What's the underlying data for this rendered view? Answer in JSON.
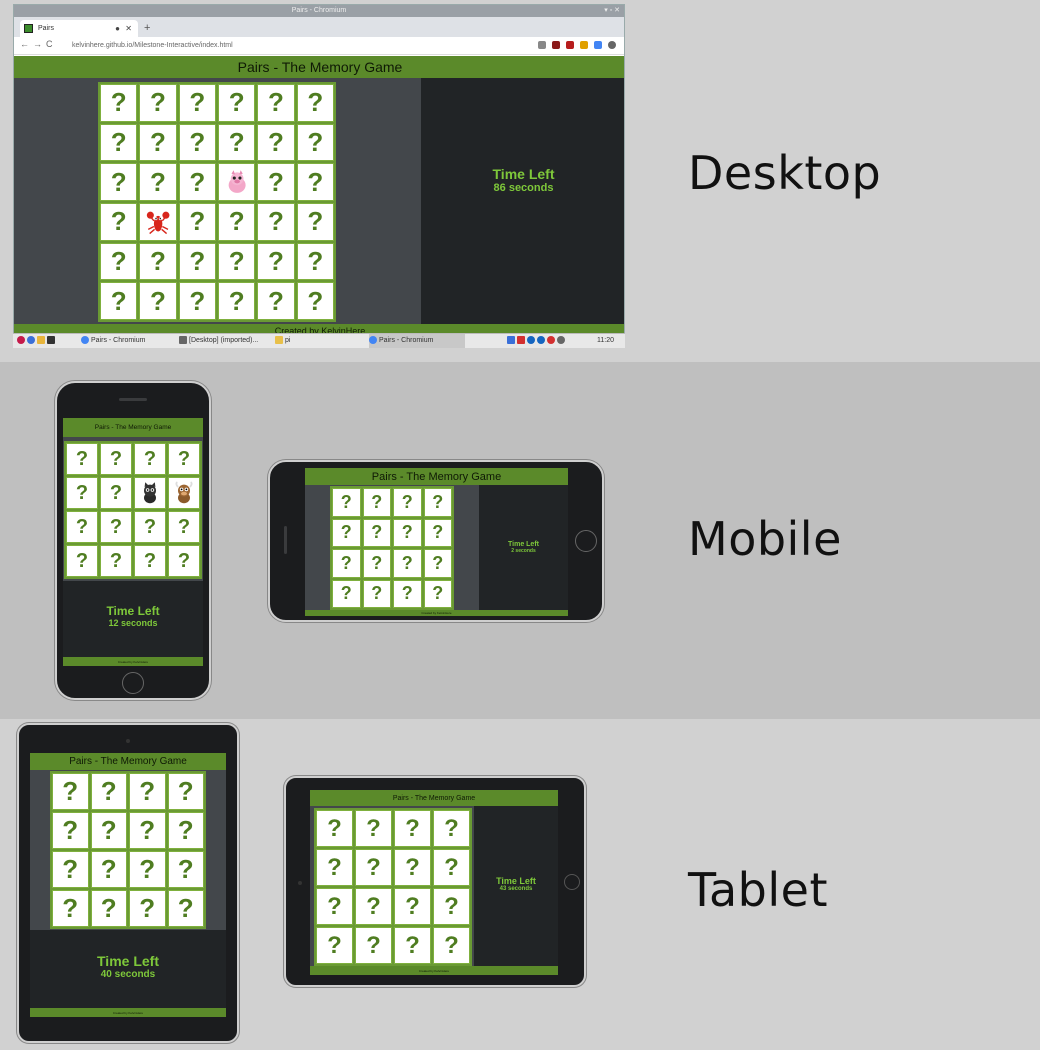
{
  "labels": {
    "desktop": "Desktop",
    "mobile": "Mobile",
    "tablet": "Tablet"
  },
  "browser": {
    "window_title": "Pairs - Chromium",
    "tab_title": "Pairs",
    "url": "kelvinhere.github.io/Milestone-Interactive/index.html"
  },
  "taskbar": {
    "item1": "Pairs - Chromium",
    "item2": "[Desktop] (imported)...",
    "item3": "pi",
    "item4": "Pairs - Chromium",
    "clock": "11:20"
  },
  "game": {
    "title": "Pairs - The Memory Game",
    "footer": "Created by KelvinHere",
    "card_face": "?",
    "timer_label": "Time Left"
  },
  "screens": {
    "desktop": {
      "time": "86 seconds",
      "revealed": [
        {
          "index": 15,
          "animal": "pig"
        },
        {
          "index": 19,
          "animal": "lobster"
        }
      ]
    },
    "phone_portrait": {
      "time": "12 seconds",
      "revealed": [
        {
          "index": 6,
          "animal": "cat"
        },
        {
          "index": 7,
          "animal": "bull"
        }
      ]
    },
    "phone_landscape": {
      "time": "2 seconds",
      "revealed": []
    },
    "tablet_portrait": {
      "time": "40 seconds",
      "revealed": []
    },
    "tablet_landscape": {
      "time": "43 seconds",
      "revealed": []
    }
  },
  "colors": {
    "header_green": "#5b8a2a",
    "timer_green": "#7ec83a",
    "card_q": "#4f7d21",
    "dark": "#212426"
  }
}
